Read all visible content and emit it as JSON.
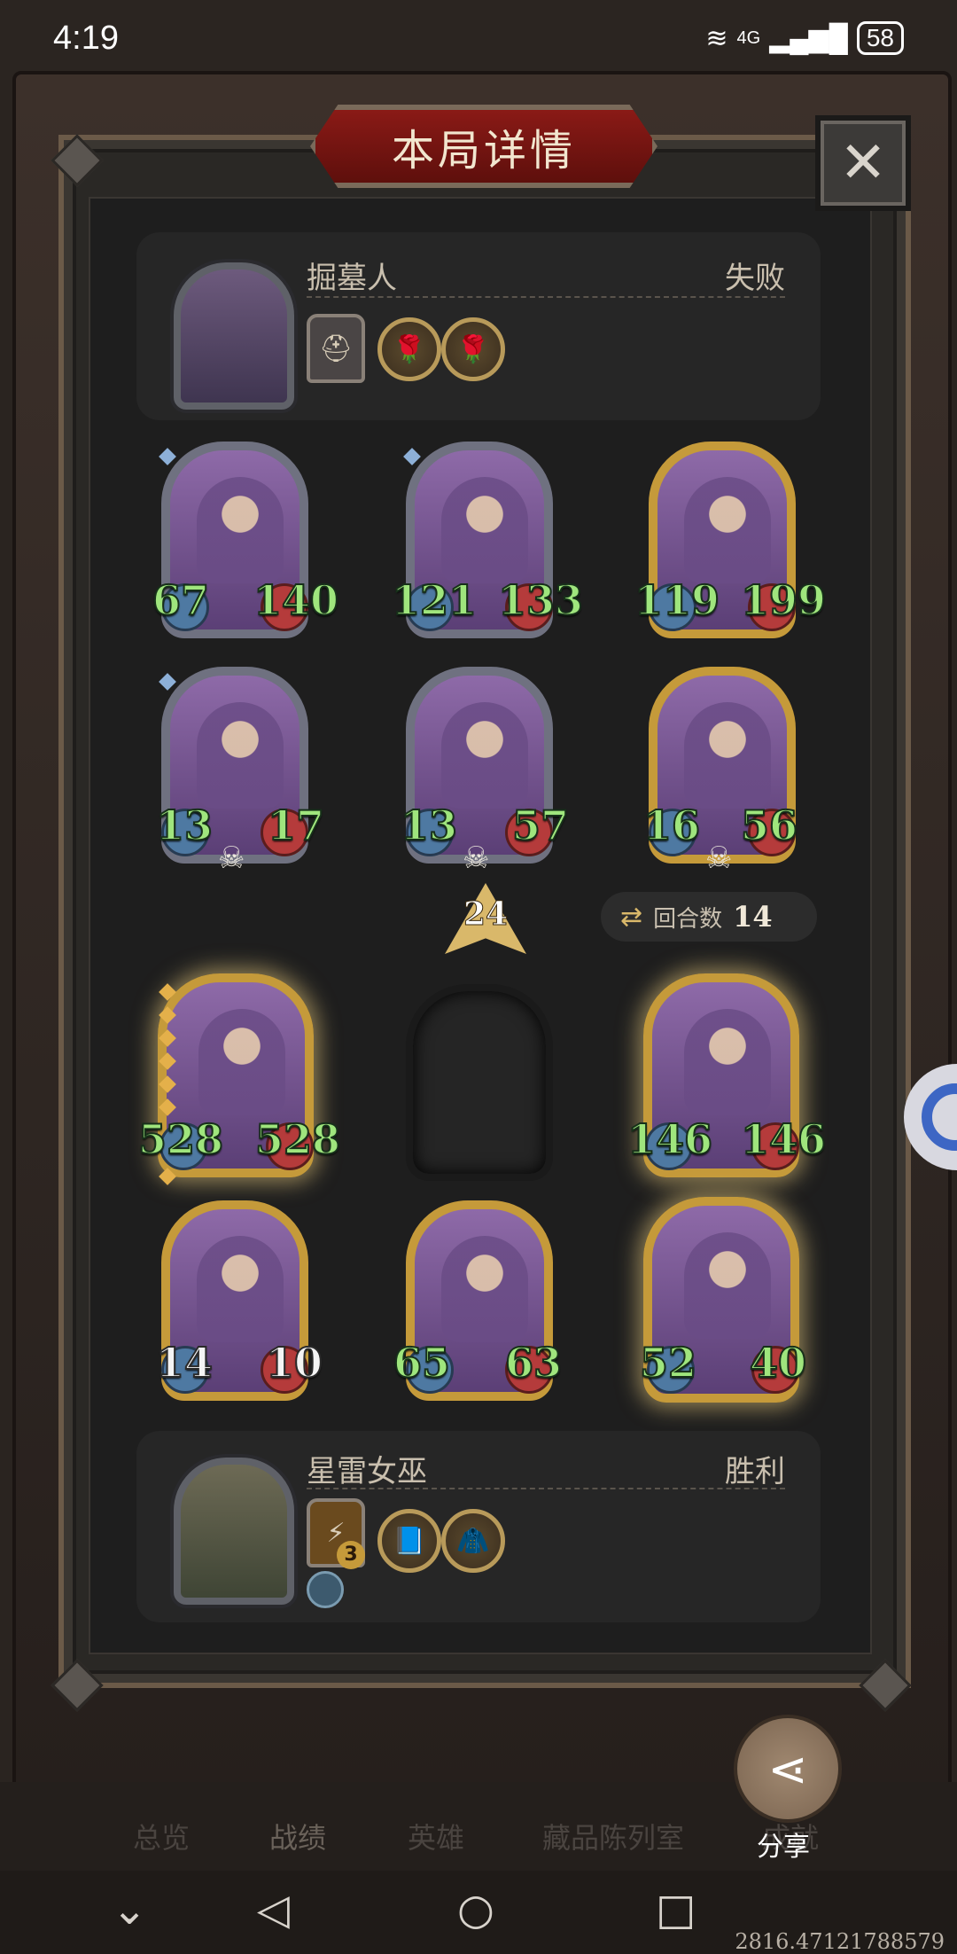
{
  "status_bar": {
    "time": "4:19",
    "network": "4G",
    "battery": "58"
  },
  "title": "本局详情",
  "close_icon": "close-icon",
  "opponent": {
    "name": "掘墓人",
    "result": "失败",
    "items": [
      "helmet-item",
      "rose-item",
      "rose-item"
    ]
  },
  "enemy_board": [
    {
      "attack": "67",
      "health": "140",
      "frame": "silver",
      "dead": false
    },
    {
      "attack": "121",
      "health": "133",
      "frame": "silver",
      "dead": false
    },
    {
      "attack": "119",
      "health": "199",
      "frame": "gold",
      "dead": false
    },
    {
      "attack": "13",
      "health": "17",
      "frame": "silver",
      "dead": true
    },
    {
      "attack": "13",
      "health": "57",
      "frame": "silver",
      "dead": true
    },
    {
      "attack": "16",
      "health": "56",
      "frame": "gold",
      "dead": true
    }
  ],
  "turn": {
    "arrow_value": "24",
    "label": "回合数",
    "value": "14"
  },
  "player_board": [
    {
      "attack": "528",
      "health": "528",
      "frame": "gold",
      "empty": false
    },
    {
      "empty": true
    },
    {
      "attack": "146",
      "health": "146",
      "frame": "gold",
      "empty": false
    },
    {
      "attack": "14",
      "health": "10",
      "frame": "gold",
      "empty": false
    },
    {
      "attack": "65",
      "health": "63",
      "frame": "gold",
      "empty": false
    },
    {
      "attack": "52",
      "health": "40",
      "frame": "gold",
      "empty": false
    }
  ],
  "player": {
    "name": "星雷女巫",
    "result": "胜利",
    "item_level": "3",
    "items": [
      "lightning-item",
      "tome-item",
      "cloak-item"
    ]
  },
  "bottom_tabs": [
    "总览",
    "战绩",
    "英雄",
    "藏品陈列室",
    "成就"
  ],
  "share_label": "分享",
  "coords_text": "2816.47121788579"
}
